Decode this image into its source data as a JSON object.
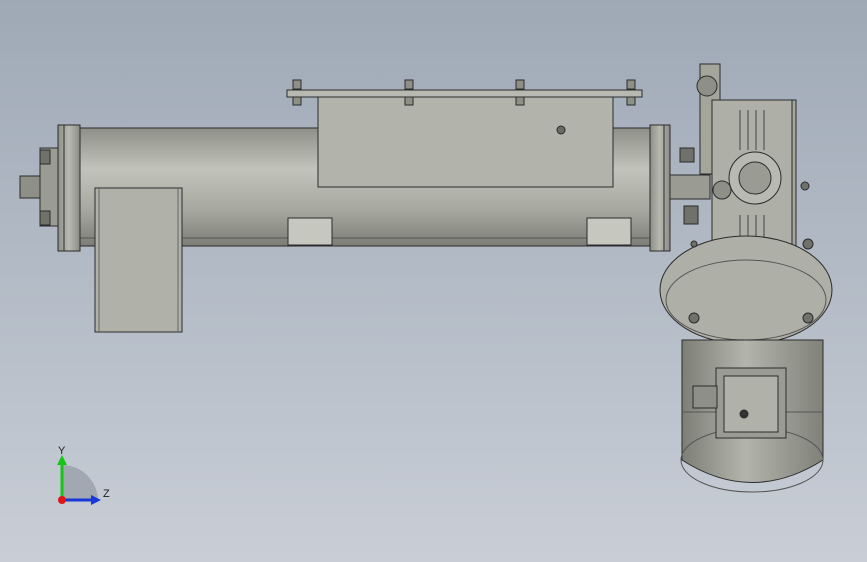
{
  "triad": {
    "y_label": "Y",
    "z_label": "Z",
    "x_color": "#e01515",
    "y_color": "#18c418",
    "z_color": "#1838d8"
  },
  "colors": {
    "background_top": "#9fa9b6",
    "background_bottom": "#c9ced6",
    "metal": "#a4a69c",
    "metal_dark": "#7d7f76",
    "outline": "#2b2b2b"
  }
}
